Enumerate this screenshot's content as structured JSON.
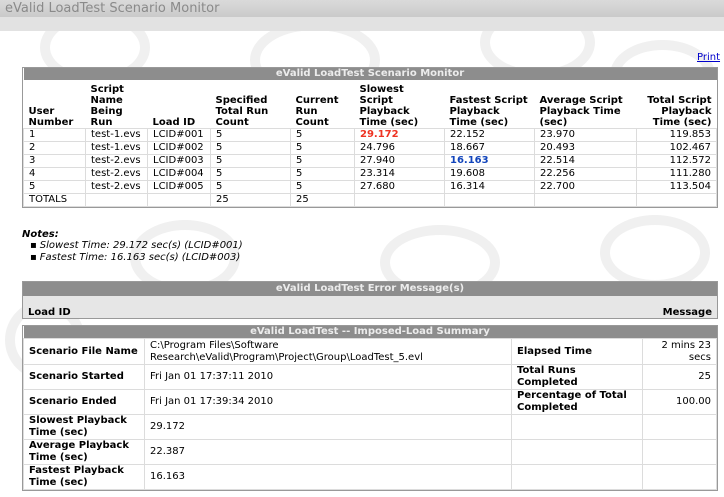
{
  "window": {
    "title": "eValid LoadTest Scenario Monitor"
  },
  "print_link": "Print",
  "monitor": {
    "header": "eValid LoadTest Scenario Monitor",
    "columns": [
      "User Number",
      "Script Name Being Run",
      "Load ID",
      "Specified Total Run Count",
      "Current Run Count",
      "Slowest Script Playback Time (sec)",
      "Fastest Script Playback Time (sec)",
      "Average Script Playback Time (sec)",
      "Total Script Playback Time (sec)"
    ],
    "rows": [
      [
        "1",
        "test-1.evs",
        "LCID#001",
        "5",
        "5",
        "29.172",
        "22.152",
        "23.970",
        "119.853"
      ],
      [
        "2",
        "test-1.evs",
        "LCID#002",
        "5",
        "5",
        "24.796",
        "18.667",
        "20.493",
        "102.467"
      ],
      [
        "3",
        "test-2.evs",
        "LCID#003",
        "5",
        "5",
        "27.940",
        "16.163",
        "22.514",
        "112.572"
      ],
      [
        "4",
        "test-2.evs",
        "LCID#004",
        "5",
        "5",
        "23.314",
        "19.608",
        "22.256",
        "111.280"
      ],
      [
        "5",
        "test-2.evs",
        "LCID#005",
        "5",
        "5",
        "27.680",
        "16.314",
        "22.700",
        "113.504"
      ]
    ],
    "totals": {
      "label": "TOTALS",
      "specified": "25",
      "current": "25"
    },
    "highlight": {
      "slowest_color": "#ee3322",
      "fastest_color": "#1144bb"
    }
  },
  "notes": {
    "title": "Notes:",
    "items": [
      "Slowest Time: 29.172 sec(s) (LCID#001)",
      "Fastest Time: 16.163 sec(s) (LCID#003)"
    ]
  },
  "errors": {
    "header": "eValid LoadTest Error Message(s)",
    "col_load_id": "Load ID",
    "col_message": "Message"
  },
  "summary": {
    "header": "eValid LoadTest -- Imposed-Load Summary",
    "scenario_file_label": "Scenario File Name",
    "scenario_file_value": "C:\\Program Files\\Software Research\\eValid\\Program\\Project\\Group\\LoadTest_5.evl",
    "elapsed_label": "Elapsed Time",
    "elapsed_value": "2 mins 23 secs",
    "started_label": "Scenario Started",
    "started_value": "Fri Jan 01 17:37:11 2010",
    "total_runs_label": "Total Runs Completed",
    "total_runs_value": "25",
    "ended_label": "Scenario Ended",
    "ended_value": "Fri Jan 01 17:39:34 2010",
    "pct_label": "Percentage of Total Completed",
    "pct_value": "100.00",
    "slowest_label": "Slowest Playback Time (sec)",
    "slowest_value": "29.172",
    "average_label": "Average Playback Time (sec)",
    "average_value": "22.387",
    "fastest_label": "Fastest Playback Time (sec)",
    "fastest_value": "16.163"
  }
}
